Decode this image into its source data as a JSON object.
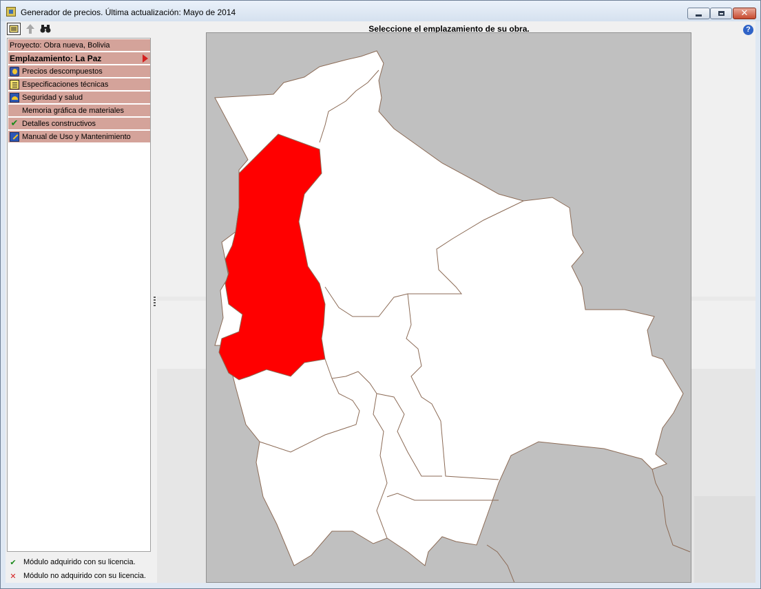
{
  "window": {
    "title": "Generador de precios. Última actualización: Mayo de 2014"
  },
  "menu": {
    "project": "Proyecto: Obra nueva, Bolivia",
    "location": "Emplazamiento: La Paz",
    "items": [
      {
        "label": "Precios descompuestos",
        "icon": "prices-icon"
      },
      {
        "label": "Especificaciones técnicas",
        "icon": "specs-icon"
      },
      {
        "label": "Seguridad y salud",
        "icon": "safety-helmet-icon"
      },
      {
        "label": "Memoria gráfica de materiales",
        "icon": ""
      },
      {
        "label": "Detalles constructivos",
        "icon": "checkmark-icon"
      },
      {
        "label": "Manual de Uso y Mantenimiento",
        "icon": "manual-icon"
      }
    ]
  },
  "map": {
    "title": "Seleccione el emplazamiento de su obra.",
    "selected_department": "La Paz",
    "colors": {
      "selected": "#ff0000",
      "department": "#ffffff",
      "border": "#8b6a55",
      "outside": "#c0c0c0"
    }
  },
  "legend": {
    "licensed": "Módulo adquirido con su licencia.",
    "not_licensed": "Módulo no adquirido con su licencia."
  }
}
